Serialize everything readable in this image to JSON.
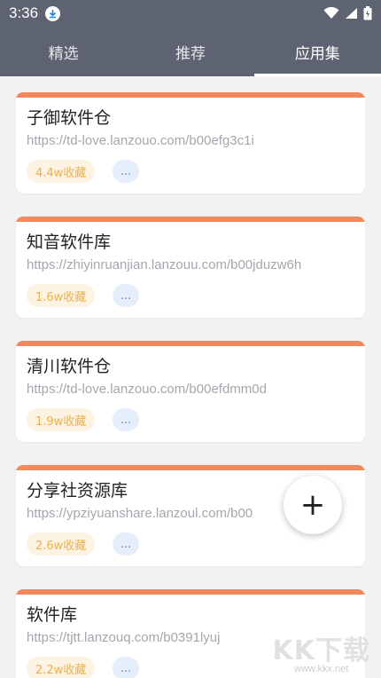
{
  "status_bar": {
    "time": "3:36"
  },
  "tabs": [
    {
      "label": "精选",
      "active": false
    },
    {
      "label": "推荐",
      "active": false
    },
    {
      "label": "应用集",
      "active": true
    }
  ],
  "cards": [
    {
      "title": "子御软件仓",
      "url": "https://td-love.lanzouo.com/b00efg3c1i",
      "favorites": "4.4w收藏",
      "more": "..."
    },
    {
      "title": "知音软件库",
      "url": "https://zhiyinruanjian.lanzouu.com/b00jduzw6h",
      "favorites": "1.6w收藏",
      "more": "..."
    },
    {
      "title": "清川软件仓",
      "url": "https://td-love.lanzouo.com/b00efdmm0d",
      "favorites": "1.9w收藏",
      "more": "..."
    },
    {
      "title": "分享社资源库",
      "url": "https://ypziyuanshare.lanzoul.com/b00",
      "favorites": "2.6w收藏",
      "more": "..."
    },
    {
      "title": "软件库",
      "url": "https://tjtt.lanzouq.com/b0391lyuj",
      "favorites": "2.2w收藏",
      "more": "..."
    }
  ],
  "fab": {
    "label": "+"
  },
  "watermark": {
    "logo": "KK下载",
    "url": "www.kkx.net"
  },
  "colors": {
    "header": "#5d6370",
    "accent": "#f08a5d",
    "badge_fav": "#eab04d",
    "badge_more": "#6d88c8"
  }
}
